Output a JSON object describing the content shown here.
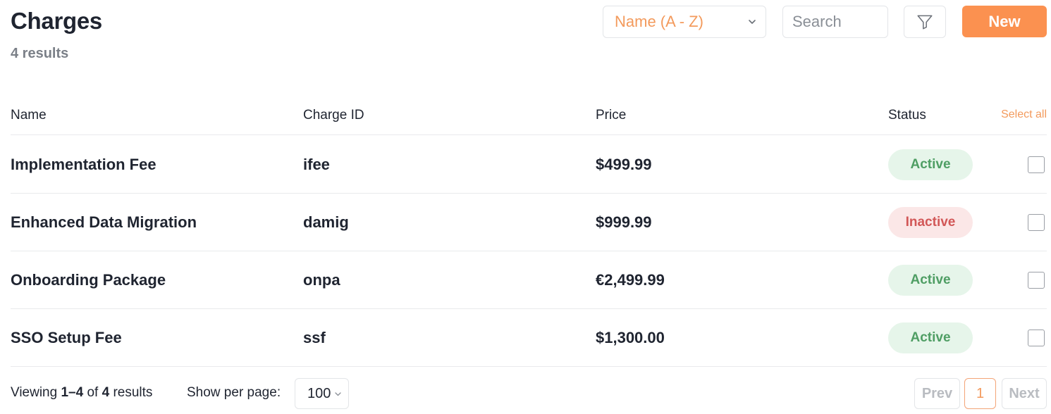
{
  "header": {
    "title": "Charges",
    "results": "4 results",
    "sort_value": "Name (A - Z)",
    "search_placeholder": "Search",
    "new_label": "New"
  },
  "table": {
    "columns": [
      "Name",
      "Charge ID",
      "Price",
      "Status"
    ],
    "select_all": "Select all",
    "rows": [
      {
        "name": "Implementation Fee",
        "charge_id": "ifee",
        "price": "$499.99",
        "status": "Active",
        "checked": false
      },
      {
        "name": "Enhanced Data Migration",
        "charge_id": "damig",
        "price": "$999.99",
        "status": "Inactive",
        "checked": false
      },
      {
        "name": "Onboarding Package",
        "charge_id": "onpa",
        "price": "€2,499.99",
        "status": "Active",
        "checked": false
      },
      {
        "name": "SSO Setup Fee",
        "charge_id": "ssf",
        "price": "$1,300.00",
        "status": "Active",
        "checked": false
      }
    ]
  },
  "footer": {
    "viewing_prefix": "Viewing",
    "viewing_range": "1–4",
    "viewing_of": "of",
    "viewing_total": "4",
    "viewing_suffix": "results",
    "per_page_label": "Show per page:",
    "per_page_value": "100",
    "prev_label": "Prev",
    "current_page": "1",
    "next_label": "Next"
  },
  "colors": {
    "accent": "#fb9150",
    "active_bg": "#e6f5ea",
    "active_text": "#4f9e64",
    "inactive_bg": "#fbe7e7",
    "inactive_text": "#d25757"
  },
  "icons": {
    "filter": "filter-funnel-icon",
    "sort_dropdown": "chevron-down-icon",
    "per_page_dropdown": "chevron-down-icon"
  }
}
